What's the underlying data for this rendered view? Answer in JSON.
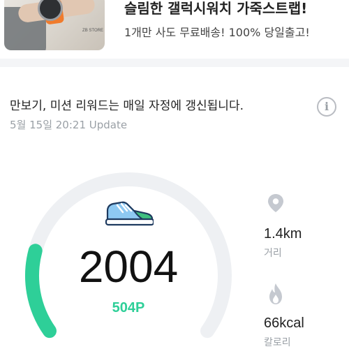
{
  "ad": {
    "title": "슬림한 갤럭시워치 가죽스트랩!",
    "subtitle": "1개만 사도 무료배송! 100% 당일출고!",
    "thumb_store_text": "ZB STORE"
  },
  "info": {
    "notice": "만보기, 미션 리워드는 매일 자정에 갱신됩니다.",
    "info_icon": "i",
    "updated": "5월 15일 20:21 Update"
  },
  "steps": {
    "count": "2004",
    "points": "504P",
    "progress_fraction": 0.2,
    "colors": {
      "track": "#eef0f3",
      "progress": "#2ecf98",
      "accent": "#2ecf98"
    }
  },
  "stats": [
    {
      "icon": "location-pin-icon",
      "value": "1.4km",
      "label": "거리"
    },
    {
      "icon": "flame-icon",
      "value": "66kcal",
      "label": "칼로리"
    }
  ]
}
